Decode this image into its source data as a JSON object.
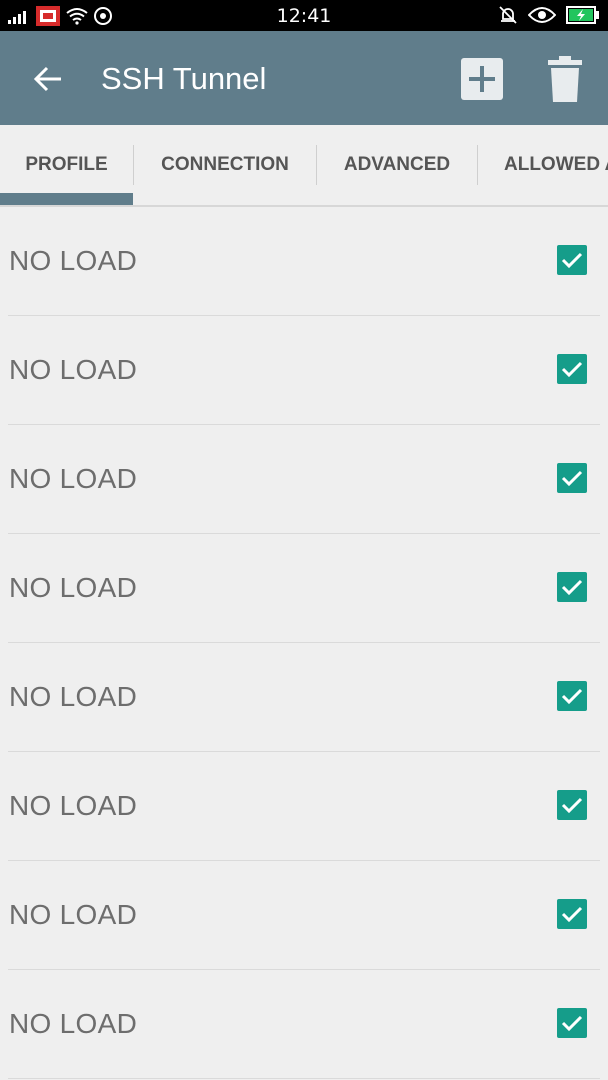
{
  "status_bar": {
    "time": "12:41"
  },
  "app_bar": {
    "title": "SSH Tunnel"
  },
  "tabs": [
    {
      "label": "PROFILE",
      "selected": true
    },
    {
      "label": "CONNECTION",
      "selected": false
    },
    {
      "label": "ADVANCED",
      "selected": false
    },
    {
      "label": "ALLOWED APPS",
      "selected": false
    }
  ],
  "rows": [
    {
      "label": "NO LOAD",
      "checked": true
    },
    {
      "label": "NO LOAD",
      "checked": true
    },
    {
      "label": "NO LOAD",
      "checked": true
    },
    {
      "label": "NO LOAD",
      "checked": true
    },
    {
      "label": "NO LOAD",
      "checked": true
    },
    {
      "label": "NO LOAD",
      "checked": true
    },
    {
      "label": "NO LOAD",
      "checked": true
    },
    {
      "label": "NO LOAD",
      "checked": true
    }
  ],
  "colors": {
    "app_bar": "#607d8b",
    "checkbox": "#159d8a",
    "status_bar": "#000000"
  }
}
